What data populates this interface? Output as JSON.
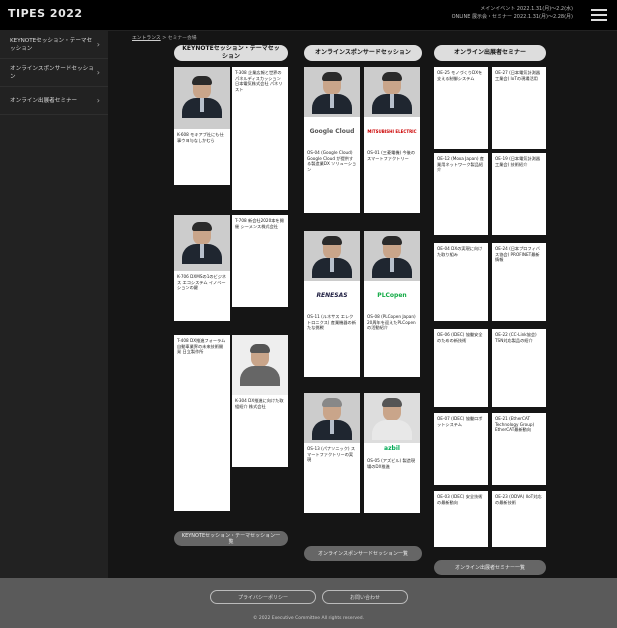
{
  "header": {
    "logo_text": "TIPES 2022",
    "event_line1": "メインイベント  2022.1.31(月)～2.2(水)",
    "event_line2": "ONLINE 展示会・セミナー  2022.1.31(月)～2.28(月)",
    "dates": "2022 1.31 ～ 2.2 / 2022 1.31 ～ 2.28"
  },
  "sidebar": {
    "items": [
      {
        "label": "KEYNOTEセッション・テーマセッション"
      },
      {
        "label": "オンラインスポンサードセッション"
      },
      {
        "label": "オンライン出展者セミナー"
      }
    ]
  },
  "breadcrumb": {
    "home": "エントランス",
    "sep": ">",
    "current": "セミナー会場"
  },
  "columns": {
    "keynote": {
      "title": "KEYNOTEセッション・テーマセッション",
      "cards": [
        {
          "id": "K-608",
          "text": "K-608 モキアブ社にも仕事ウヨ与なしかむら"
        },
        {
          "id": "T-308",
          "text": "T-308 企業広報と世界のパネルディスカッション 日本電気株式会社 パネリスト"
        },
        {
          "id": "K-706",
          "text": "K-706 DXMSの1のビジネス エコシステム イノベーションの鍵"
        },
        {
          "id": "T-708",
          "text": "T-708 新会社2020本を開催 シーメンス株式会社"
        },
        {
          "id": "T-408",
          "text": "T-408 DX推進フォーラム 自動車業界の未来技術開発 日立製作所"
        },
        {
          "id": "K-304",
          "text": "K-304 DX推進に向けた取組紹介 株式会社"
        }
      ],
      "more_button": "KEYNOTEセッション・テーマセッション一覧"
    },
    "sponsored": {
      "title": "オンラインスポンサードセッション",
      "cards": [
        {
          "id": "OS-04",
          "logo": "Google Cloud",
          "text": "OS-04 (Google Cloud) Google Cloud が提供する製造業DX ソリューション"
        },
        {
          "id": "OS-01",
          "logo": "MITSUBISHI ELECTRIC",
          "text": "OS-01 (三菱電機) 今後のスマートファクトリー"
        },
        {
          "id": "OS-11",
          "logo": "RENESAS",
          "text": "OS-11 (ルネサス エレクトロニクス) 産業機器の新たな挑戦"
        },
        {
          "id": "OS-08",
          "logo": "PLCopen",
          "text": "OS-08 (PLCopen Japan) 20周年を迎えたPLCopenの活動紹介"
        },
        {
          "id": "OS-13",
          "logo": "",
          "text": "OS-13 (パナソニック) スマートファクトリーの実現"
        },
        {
          "id": "OS-05",
          "logo": "azbil",
          "text": "OS-05 (アズビル) 製造現場のDX推進"
        }
      ],
      "more_button": "オンラインスポンサードセッション一覧"
    },
    "exhibitor": {
      "title": "オンライン出展者セミナー",
      "cards": [
        {
          "id": "OE-25",
          "text": "OE-25 モノづくりDXを支える制御システム"
        },
        {
          "id": "OE-27",
          "text": "OE-27 (日本電気計測器工業会) IoTの現場活用"
        },
        {
          "id": "OE-12",
          "text": "OE-12 (Moxa Japan) 産業用ネットワーク製品紹介"
        },
        {
          "id": "OE-19",
          "text": "OE-19 (日本電気計測器工業会) 技術紹介"
        },
        {
          "id": "OE-04",
          "text": "OE-04 DXの実現に向けた取り組み"
        },
        {
          "id": "OE-24",
          "text": "OE-24 (日本プロフィバス協会) PROFINET最新情報"
        },
        {
          "id": "OE-06",
          "text": "OE-06 (IDEC) 協働安全のための新技術"
        },
        {
          "id": "OE-22",
          "text": "OE-22 (CC-Link協会) TSN対応製品の紹介"
        },
        {
          "id": "OE-07",
          "text": "OE-07 (IDEC) 協働ロボットシステム"
        },
        {
          "id": "OE-21",
          "text": "OE-21 (EtherCAT Technology Group) EtherCAT最新動向"
        },
        {
          "id": "OE-03",
          "text": "OE-03 (IDEC) 安全技術の最新動向"
        },
        {
          "id": "OE-23",
          "text": "OE-23 (ODVA) IIoT対応の最新技術"
        }
      ],
      "more_button": "オンライン出展者セミナー一覧"
    }
  },
  "footer": {
    "privacy": "プライバシーポリシー",
    "contact": "お問い合わせ",
    "copyright": "© 2022 Executive Committee All rights reserved."
  }
}
